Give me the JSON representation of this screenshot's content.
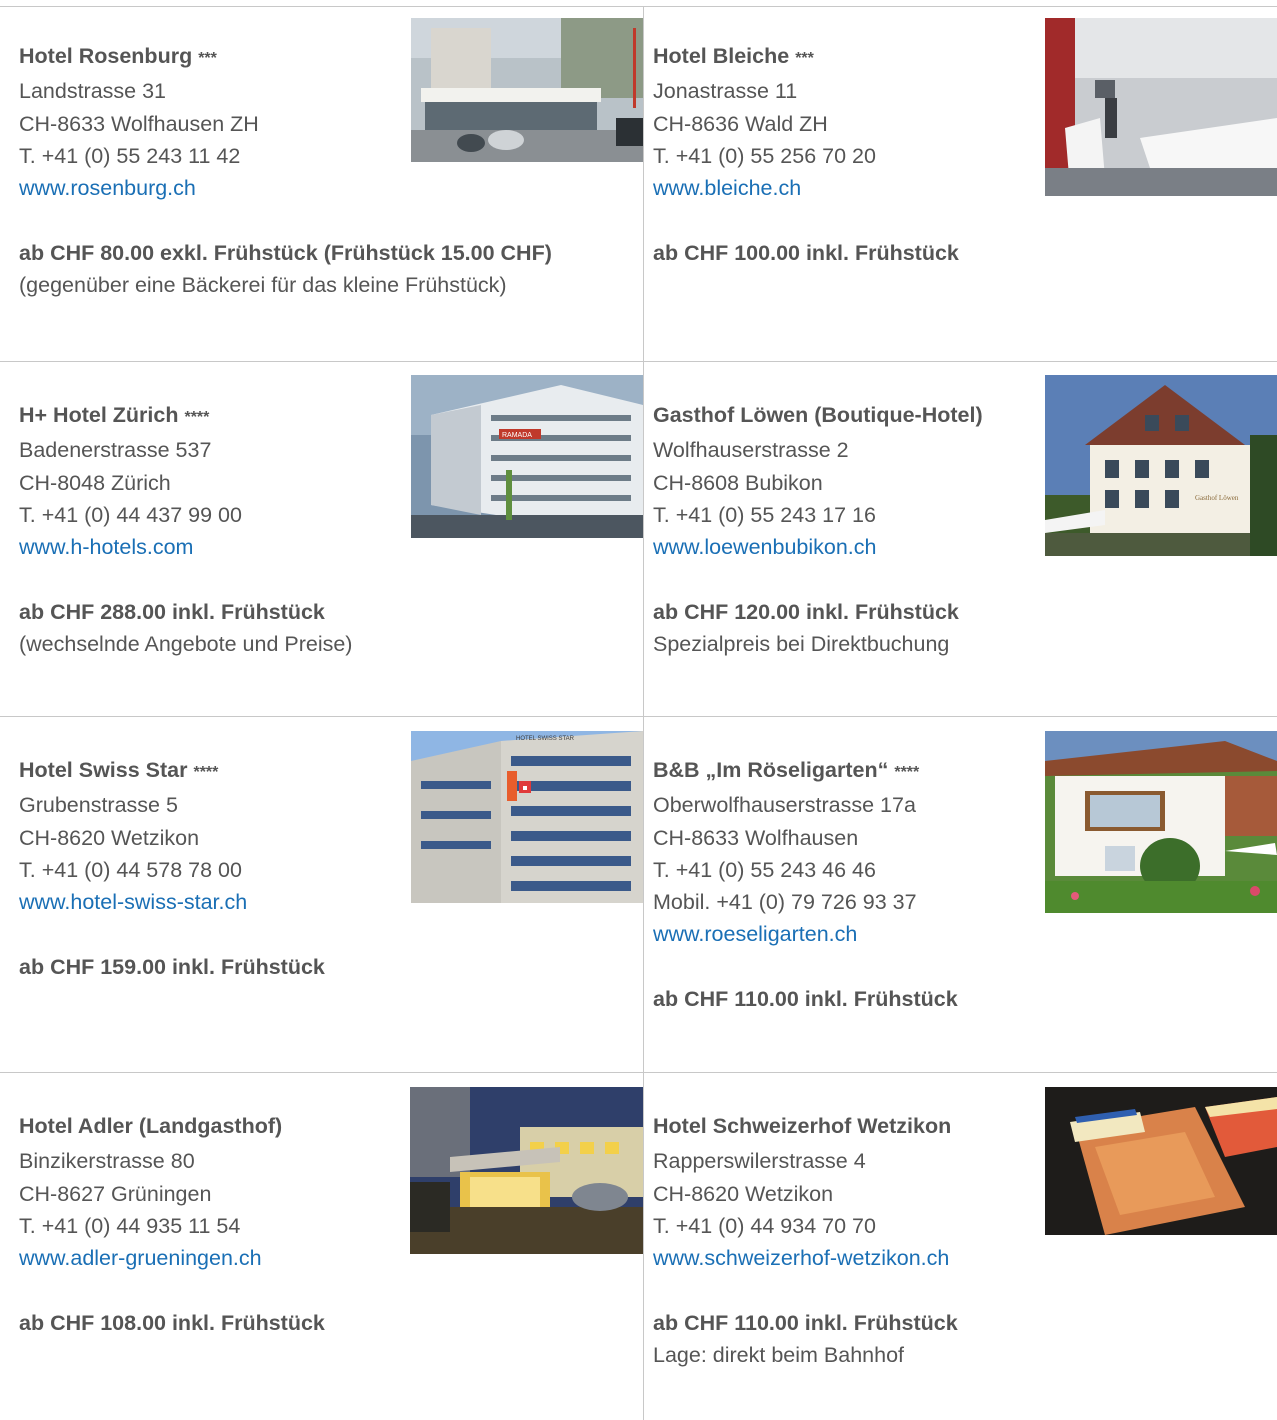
{
  "hotels": [
    {
      "name": "Hotel Rosenburg",
      "stars": "***",
      "street": "Landstrasse 31",
      "city": "CH-8633 Wolfhausen ZH",
      "phone": "T. +41 (0) 55 243 11 42",
      "mobile": "",
      "url": "www.rosenburg.ch",
      "price": "ab CHF 80.00 exkl. Frühstück (Frühstück 15.00 CHF)",
      "note": "(gegenüber eine Bäckerei für das kleine Frühstück)"
    },
    {
      "name": "Hotel Bleiche",
      "stars": "***",
      "street": "Jonastrasse 11",
      "city": "CH-8636 Wald ZH",
      "phone": "T. +41 (0) 55 256 70 20",
      "mobile": "",
      "url": "www.bleiche.ch",
      "price": "ab CHF 100.00 inkl. Frühstück",
      "note": ""
    },
    {
      "name": "H+ Hotel Zürich",
      "stars": "****",
      "street": "Badenerstrasse 537",
      "city": "CH-8048 Zürich",
      "phone": "T. +41 (0) 44 437 99 00",
      "mobile": "",
      "url": "www.h-hotels.com",
      "price": "ab CHF 288.00 inkl. Frühstück",
      "note": "(wechselnde Angebote und Preise)"
    },
    {
      "name": "Gasthof Löwen (Boutique-Hotel)",
      "stars": "",
      "street": "Wolfhauserstrasse 2",
      "city": "CH-8608 Bubikon",
      "phone": "T. +41 (0) 55 243 17 16",
      "mobile": "",
      "url": "www.loewenbubikon.ch",
      "price": "ab CHF 120.00 inkl. Frühstück",
      "note": "Spezialpreis bei Direktbuchung"
    },
    {
      "name": "Hotel Swiss Star",
      "stars": "****",
      "street": "Grubenstrasse 5",
      "city": "CH-8620 Wetzikon",
      "phone": "T. +41 (0) 44 578 78 00",
      "mobile": "",
      "url": "www.hotel-swiss-star.ch",
      "price": "ab CHF 159.00 inkl. Frühstück",
      "note": ""
    },
    {
      "name": "B&B „Im Röseligarten“",
      "stars": "****",
      "street": "Oberwolfhauserstrasse 17a",
      "city": "CH-8633 Wolfhausen",
      "phone": "T. +41 (0) 55 243 46 46",
      "mobile": "Mobil. +41 (0) 79 726 93 37",
      "url": "www.roeseligarten.ch",
      "price": "ab CHF 110.00 inkl. Frühstück",
      "note": ""
    },
    {
      "name": "Hotel Adler (Landgasthof)",
      "stars": "",
      "street": "Binzikerstrasse 80",
      "city": "CH-8627 Grüningen",
      "phone": "T. +41 (0) 44 935 11 54",
      "mobile": "",
      "url": "www.adler-grueningen.ch",
      "price": "ab CHF 108.00 inkl. Frühstück",
      "note": ""
    },
    {
      "name": "Hotel Schweizerhof Wetzikon",
      "stars": "",
      "street": "Rapperswilerstrasse 4",
      "city": "CH-8620 Wetzikon",
      "phone": "T. +41 (0) 44 934 70 70",
      "mobile": "",
      "url": "www.schweizerhof-wetzikon.ch",
      "price": "ab CHF 110.00 inkl. Frühstück",
      "note": "Lage: direkt beim Bahnhof"
    }
  ],
  "photo_signs": {
    "h_hotel_sign": "RAMADA",
    "swiss_star_sign": "HOTEL SWISS STAR",
    "loewen_sign": "Gasthof Löwen"
  }
}
